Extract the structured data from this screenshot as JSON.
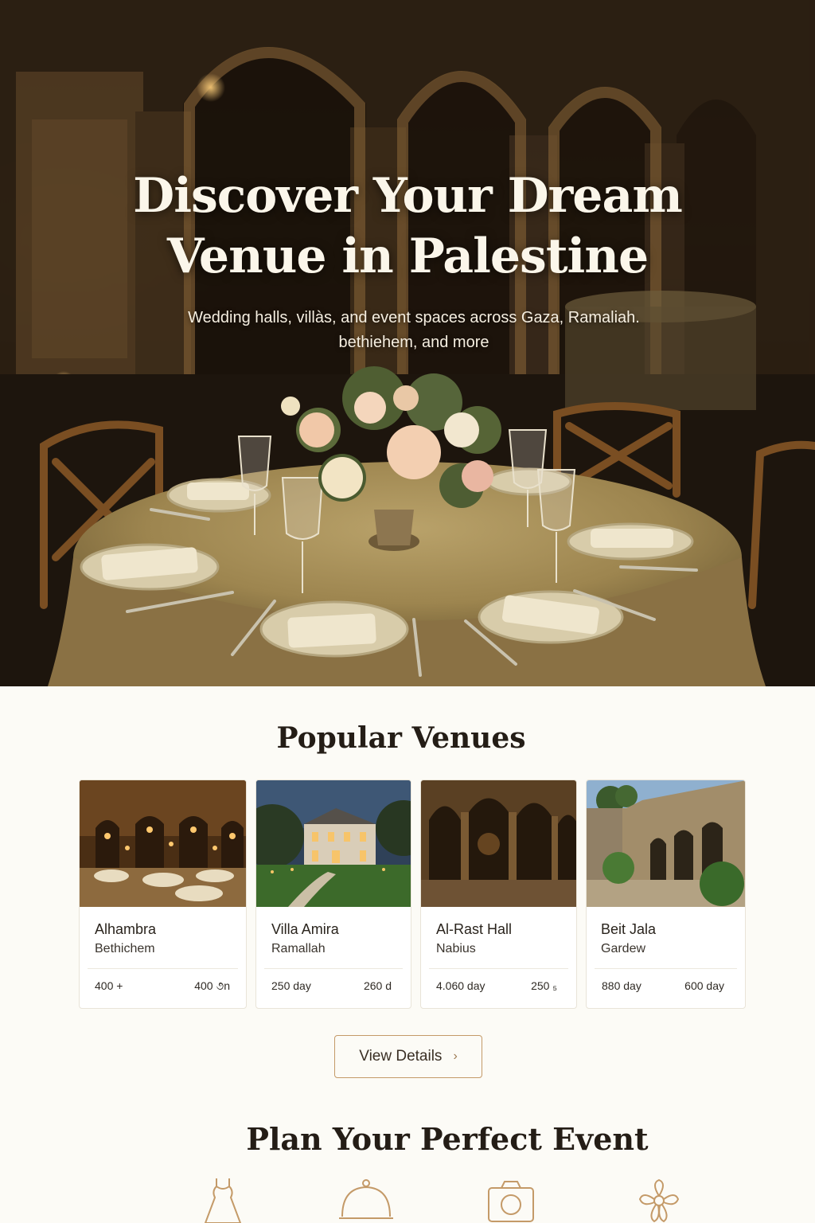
{
  "hero": {
    "title_line1": "Discover Your Dream",
    "title_line2": "Venue in Palestine",
    "subtitle_line1": "Wedding halls, villàs, and event spaces across Gaza, Ramaliah.",
    "subtitle_line2": "bethiehem, and more"
  },
  "popular": {
    "title": "Popular Venues",
    "venues": [
      {
        "name": "Alhambra",
        "city": "Bethichem",
        "price_a": "400 +",
        "price_b": "400 ૭n",
        "photo_icon": "ballroom-photo"
      },
      {
        "name": "Villa Amira",
        "city": "Ramallah",
        "price_a": "250 day",
        "price_b": "260 d",
        "photo_icon": "villa-photo"
      },
      {
        "name": "Al-Rast Hall",
        "city": "Nabius",
        "price_a": "4.060 day",
        "price_b": "250 ₅",
        "photo_icon": "arches-photo"
      },
      {
        "name": "Beit Jala",
        "city": "Gardew",
        "price_a": "880 day",
        "price_b": "600 day",
        "photo_icon": "stone-courtyard-photo"
      }
    ],
    "cta_label": "View Details"
  },
  "plan": {
    "title": "Plan Your Perfect Event",
    "icons": [
      "dress-icon",
      "catering-cloche-icon",
      "camera-icon",
      "flower-icon"
    ]
  },
  "colors": {
    "accent": "#c49a68",
    "page_bg": "#fcfbf6",
    "hero_text": "#fbf6ea"
  }
}
